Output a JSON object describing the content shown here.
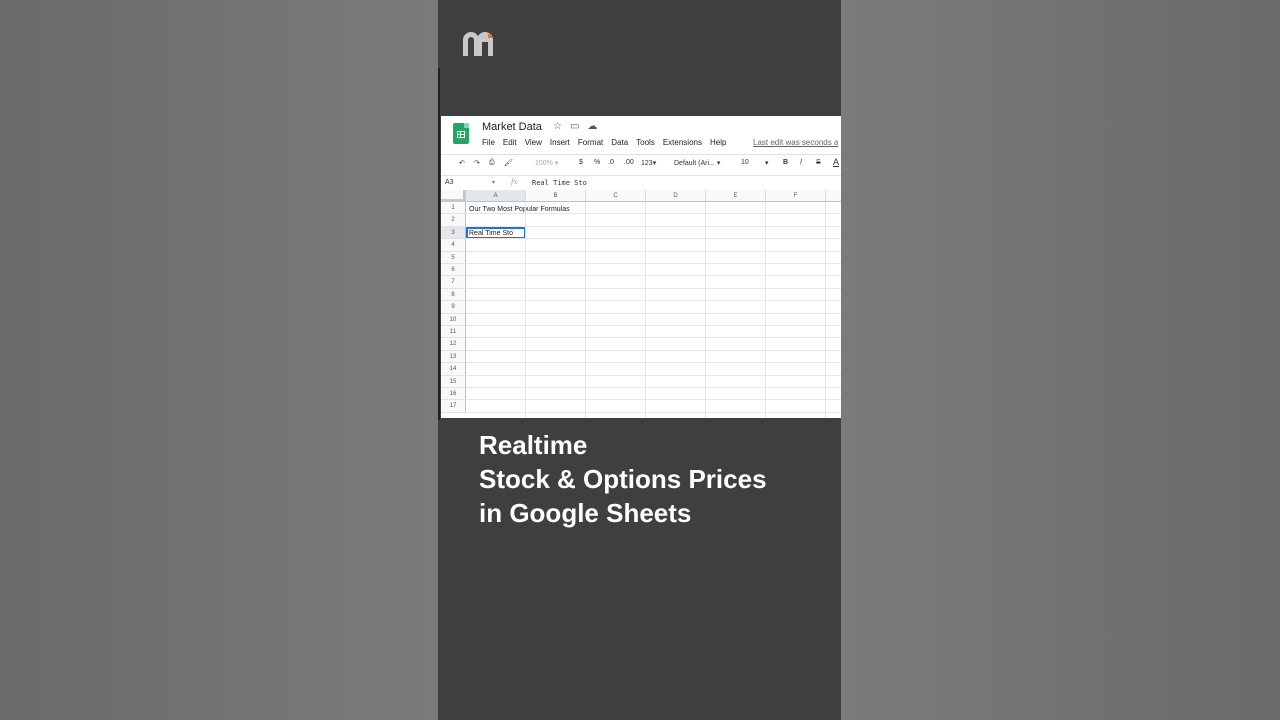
{
  "video": {
    "caption_lines": [
      "Realtime",
      "Stock & Options Prices",
      "in Google Sheets"
    ]
  },
  "logo": {
    "icon": "channel-logo-icon",
    "color": "#c9c9c9",
    "accent": "#e8702a"
  },
  "sheets": {
    "doc_title": "Market Data",
    "title_icons": [
      "star-icon",
      "move-folder-icon",
      "cloud-status-icon"
    ],
    "menu": [
      "File",
      "Edit",
      "View",
      "Insert",
      "Format",
      "Data",
      "Tools",
      "Extensions",
      "Help"
    ],
    "last_edit": "Last edit was seconds a",
    "toolbar": {
      "zoom": "100%",
      "currency": "$",
      "percent": "%",
      "dec_decrease": ".0",
      "dec_increase": ".00",
      "number_format": "123",
      "font": "Default (Ari...",
      "font_size": "10",
      "bold": "B",
      "italic": "I",
      "strike": "S",
      "text_color": "A"
    },
    "name_box": "A3",
    "fx": "fx",
    "formula_value": "Real Time Sto",
    "columns": [
      "A",
      "B",
      "C",
      "D",
      "E",
      "F"
    ],
    "rows": [
      "1",
      "2",
      "3",
      "4",
      "5",
      "6",
      "7",
      "8",
      "9",
      "10",
      "11",
      "12",
      "13",
      "14",
      "15",
      "16",
      "17"
    ],
    "cells": {
      "A1": "Our Two Most Popular Formulas",
      "A3": "Real Time Sto"
    },
    "accent": "#1a73e8",
    "brand_green": "#23a566"
  }
}
